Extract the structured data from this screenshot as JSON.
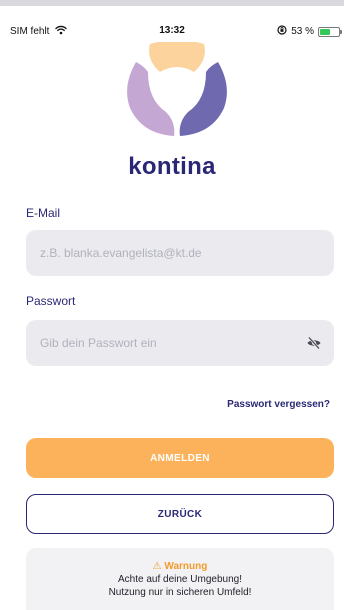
{
  "status_bar": {
    "carrier": "SIM fehlt",
    "time": "13:32",
    "battery_percent": "53 %",
    "battery_level": 0.53,
    "wifi_icon": "wifi-icon",
    "orientation_lock_icon": "orientation-lock-icon",
    "battery_color": "#34c759"
  },
  "brand": {
    "name": "kontina",
    "colors": {
      "peach": "#fcd39d",
      "lavender": "#c5a7d4",
      "indigo": "#6f69b0",
      "text": "#2a2875"
    }
  },
  "form": {
    "email": {
      "label": "E-Mail",
      "placeholder": "z.B. blanka.evangelista@kt.de",
      "value": ""
    },
    "password": {
      "label": "Passwort",
      "placeholder": "Gib dein Passwort ein",
      "value": "",
      "toggle_icon": "eye-off-icon"
    },
    "forgot_password": "Passwort vergessen?",
    "login_button": "ANMELDEN",
    "back_button": "ZURÜCK"
  },
  "warning": {
    "icon": "warning-icon",
    "title": "Warnung",
    "line1": "Achte auf deine Umgebung!",
    "line2": "Nutzung nur in sicheren Umfeld!"
  },
  "colors": {
    "accent": "#fbb25b",
    "primary": "#2a2875",
    "field_bg": "#eaeaef",
    "warning_title": "#f39b2b"
  }
}
